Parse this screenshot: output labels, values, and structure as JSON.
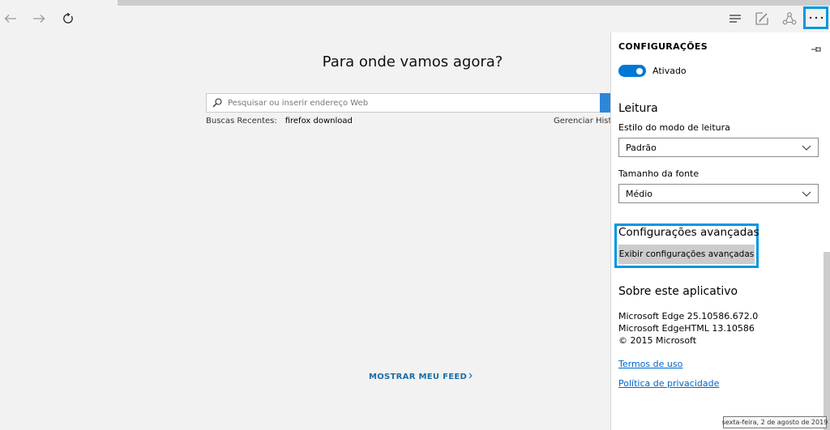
{
  "main": {
    "title": "Para onde vamos agora?",
    "search_placeholder": "Pesquisar ou inserir endereço Web",
    "recent_label": "Buscas Recentes:",
    "recent_item": "firefox download",
    "manage_history": "Gerenciar Histórico",
    "feed_label": "MOSTRAR MEU FEED"
  },
  "settings": {
    "title": "CONFIGURAÇÕES",
    "toggle_label": "Ativado",
    "reading_heading": "Leitura",
    "reading_style_label": "Estilo do modo de leitura",
    "reading_style_value": "Padrão",
    "font_size_label": "Tamanho da fonte",
    "font_size_value": "Médio",
    "advanced_heading": "Configurações avançadas",
    "advanced_button": "Exibir configurações avançadas",
    "about_heading": "Sobre este aplicativo",
    "about_line1": "Microsoft Edge 25.10586.672.0",
    "about_line2": "Microsoft EdgeHTML 13.10586",
    "about_line3": "© 2015 Microsoft",
    "terms_link": "Termos de uso",
    "privacy_link": "Política de privacidade"
  },
  "tooltip": "sexta-feira, 2 de agosto de 2019",
  "colors": {
    "accent": "#0078d7",
    "highlight_border": "#0097e0",
    "link": "#0066cc"
  },
  "icons": [
    "back-icon",
    "forward-icon",
    "refresh-icon",
    "hub-icon",
    "web-note-icon",
    "share-icon",
    "more-icon",
    "search-icon",
    "pin-icon",
    "chevron-down-icon"
  ]
}
